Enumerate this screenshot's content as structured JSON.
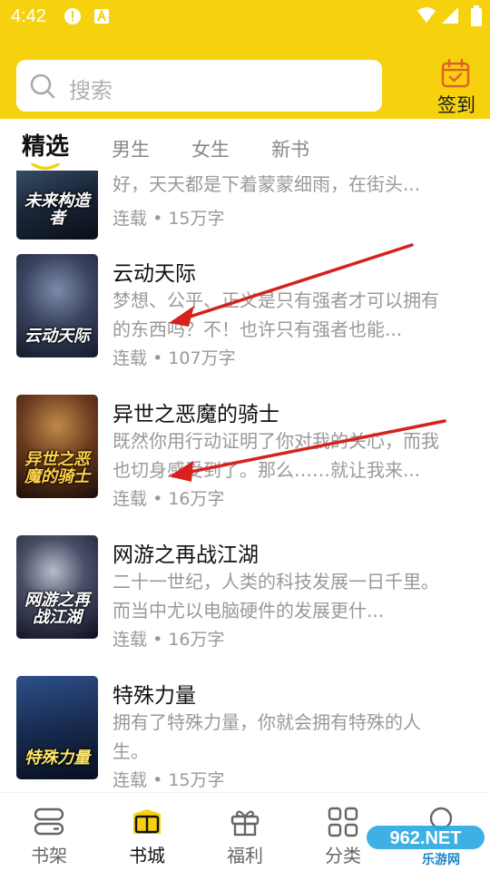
{
  "status_bar": {
    "time": "4:42"
  },
  "search": {
    "placeholder": "搜索"
  },
  "checkin": {
    "label": "签到"
  },
  "tabs": [
    {
      "label": "精选",
      "active": true
    },
    {
      "label": "男生",
      "active": false
    },
    {
      "label": "女生",
      "active": false
    },
    {
      "label": "新书",
      "active": false
    }
  ],
  "books": [
    {
      "cover_text": "未来构造者",
      "desc": "好，天天都是下着蒙蒙细雨，在街头...",
      "status": "连载",
      "words": "15万字"
    },
    {
      "title": "云动天际",
      "cover_text": "云动天际",
      "desc": "梦想、公平、正义是只有强者才可以拥有的东西吗？不！也许只有强者也能...",
      "status": "连载",
      "words": "107万字"
    },
    {
      "title": "异世之恶魔的骑士",
      "cover_text": "异世之恶魔的骑士",
      "desc": "既然你用行动证明了你对我的关心，而我也切身感受到了。那么……就让我来...",
      "status": "连载",
      "words": "16万字"
    },
    {
      "title": "网游之再战江湖",
      "cover_text": "网游之再战江湖",
      "desc": "二十一世纪，人类的科技发展一日千里。而当中尤以电脑硬件的发展更什...",
      "status": "连载",
      "words": "16万字"
    },
    {
      "title": "特殊力量",
      "cover_text": "特殊力量",
      "desc": "拥有了特殊力量，你就会拥有特殊的人生。",
      "status": "连载",
      "words": "15万字"
    }
  ],
  "bottom_nav": [
    {
      "label": "书架",
      "icon": "shelf-icon",
      "active": false
    },
    {
      "label": "书城",
      "icon": "bookstore-icon",
      "active": true
    },
    {
      "label": "福利",
      "icon": "gift-icon",
      "active": false
    },
    {
      "label": "分类",
      "icon": "category-icon",
      "active": false
    },
    {
      "label": "",
      "icon": "profile-icon",
      "active": false
    }
  ],
  "watermark": {
    "text_top": "962.NET",
    "text_bottom": "乐游网"
  },
  "colors": {
    "accent": "#f6d20e",
    "annotation_arrow": "#d6211e"
  }
}
